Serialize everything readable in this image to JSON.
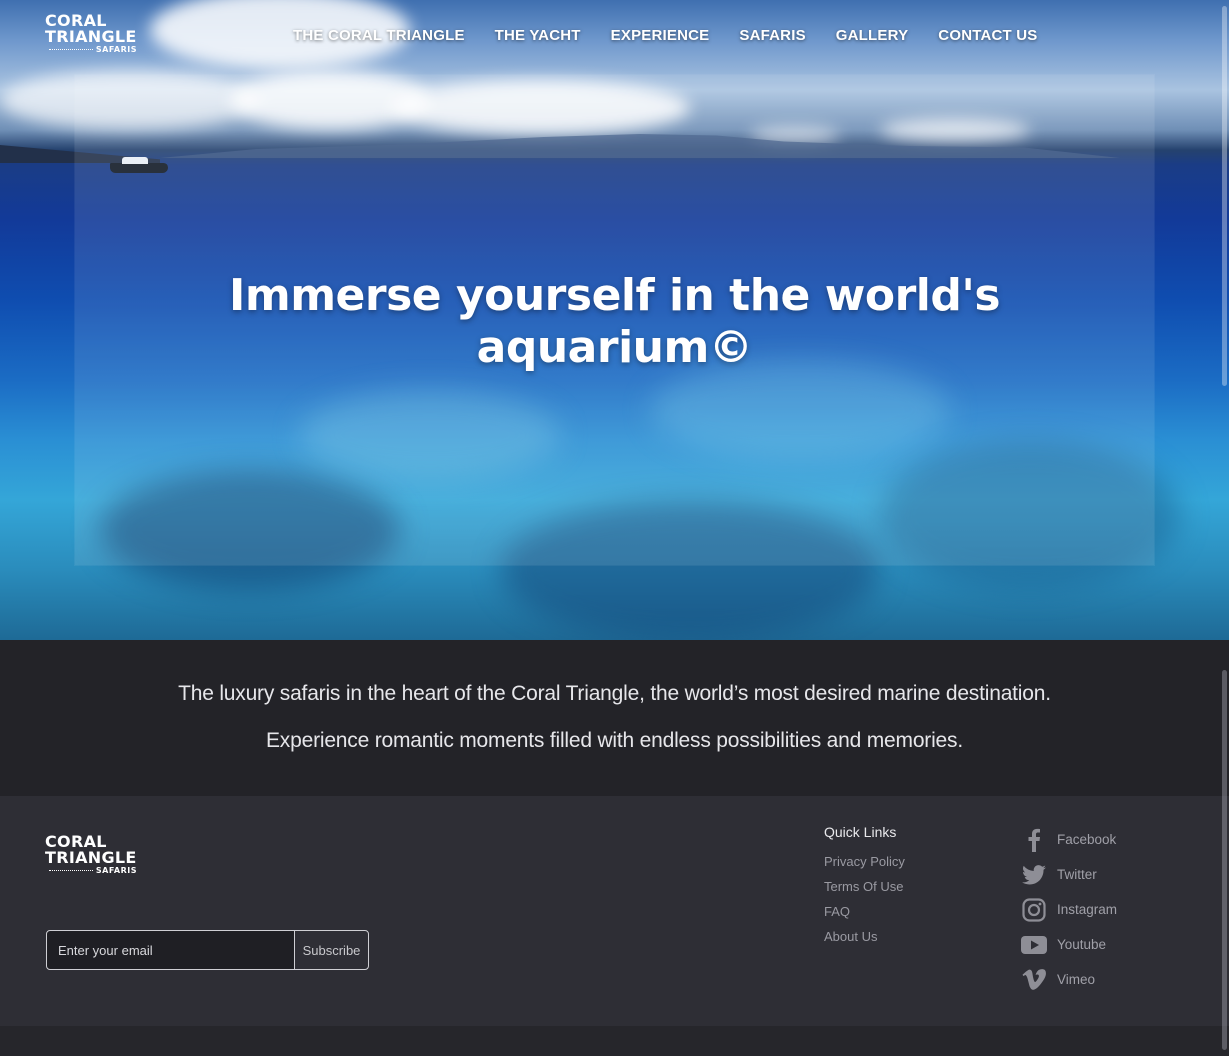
{
  "brand": {
    "line1": "CORAL",
    "line2": "TRIANGLE",
    "line3": "SAFARIS"
  },
  "nav": {
    "items": [
      {
        "label": "THE CORAL TRIANGLE"
      },
      {
        "label": "THE YACHT"
      },
      {
        "label": "EXPERIENCE"
      },
      {
        "label": "SAFARIS"
      },
      {
        "label": "GALLERY"
      },
      {
        "label": "CONTACT US"
      }
    ]
  },
  "hero": {
    "title_line1": "Immerse yourself in the world's",
    "title_line2": "aquarium©"
  },
  "intro": {
    "line1": "The luxury safaris in the heart of the Coral Triangle, the world’s most desired marine destination.",
    "line2": "Experience romantic moments filled with endless possibilities and memories."
  },
  "footer": {
    "newsletter": {
      "placeholder": "Enter your email",
      "button": "Subscribe"
    },
    "quick_links": {
      "title": "Quick Links",
      "items": [
        "Privacy Policy",
        "Terms Of Use",
        "FAQ",
        "About Us"
      ]
    },
    "social": [
      {
        "label": "Facebook",
        "icon": "facebook-icon"
      },
      {
        "label": "Twitter",
        "icon": "twitter-icon"
      },
      {
        "label": "Instagram",
        "icon": "instagram-icon"
      },
      {
        "label": "Youtube",
        "icon": "youtube-icon"
      },
      {
        "label": "Vimeo",
        "icon": "vimeo-icon"
      }
    ]
  },
  "colors": {
    "intro_bg": "#232328",
    "footer_bg": "#2e2e35",
    "text_light": "#ffffff",
    "link_muted": "#9a9aa2"
  }
}
